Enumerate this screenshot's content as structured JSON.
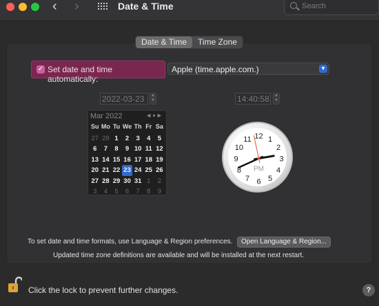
{
  "window": {
    "title": "Date & Time",
    "search_placeholder": "Search"
  },
  "tabs": [
    {
      "label": "Date & Time",
      "active": true
    },
    {
      "label": "Time Zone",
      "active": false
    }
  ],
  "auto": {
    "label": "Set date and time automatically:",
    "checked": true,
    "server": "Apple (time.apple.com.)"
  },
  "date_field": "2022-03-23",
  "time_field": "14:40:58",
  "calendar": {
    "month": "Mar 2022",
    "weekdays": [
      "Su",
      "Mo",
      "Tu",
      "We",
      "Th",
      "Fr",
      "Sa"
    ],
    "days": [
      {
        "d": "27",
        "dim": true
      },
      {
        "d": "28",
        "dim": true
      },
      {
        "d": "1"
      },
      {
        "d": "2"
      },
      {
        "d": "3"
      },
      {
        "d": "4"
      },
      {
        "d": "5"
      },
      {
        "d": "6"
      },
      {
        "d": "7"
      },
      {
        "d": "8"
      },
      {
        "d": "9"
      },
      {
        "d": "10"
      },
      {
        "d": "11"
      },
      {
        "d": "12"
      },
      {
        "d": "13"
      },
      {
        "d": "14"
      },
      {
        "d": "15"
      },
      {
        "d": "16"
      },
      {
        "d": "17"
      },
      {
        "d": "18"
      },
      {
        "d": "19"
      },
      {
        "d": "20"
      },
      {
        "d": "21"
      },
      {
        "d": "22"
      },
      {
        "d": "23",
        "selected": true
      },
      {
        "d": "24"
      },
      {
        "d": "25"
      },
      {
        "d": "26"
      },
      {
        "d": "27"
      },
      {
        "d": "28"
      },
      {
        "d": "29"
      },
      {
        "d": "30"
      },
      {
        "d": "31"
      },
      {
        "d": "1",
        "dim": true
      },
      {
        "d": "2",
        "dim": true
      },
      {
        "d": "3",
        "dim": true
      },
      {
        "d": "4",
        "dim": true
      },
      {
        "d": "5",
        "dim": true
      },
      {
        "d": "6",
        "dim": true
      },
      {
        "d": "7",
        "dim": true
      },
      {
        "d": "8",
        "dim": true
      },
      {
        "d": "9",
        "dim": true
      }
    ]
  },
  "clock": {
    "numerals": [
      "12",
      "1",
      "2",
      "3",
      "4",
      "5",
      "6",
      "7",
      "8",
      "9",
      "10",
      "11"
    ],
    "ampm": "PM",
    "hour": 14,
    "minute": 40,
    "second": 58,
    "second_hand_color": "#e0552a"
  },
  "footer": {
    "formats_text": "To set date and time formats, use Language & Region preferences.",
    "region_button": "Open Language & Region...",
    "tz_note": "Updated time zone definitions are available and will be installed at the next restart.",
    "lock_text": "Click the lock to prevent further changes.",
    "help_label": "?"
  },
  "colors": {
    "accent": "#2f6ad0",
    "highlight": "#7a2750",
    "lock": "#e0a23a"
  }
}
